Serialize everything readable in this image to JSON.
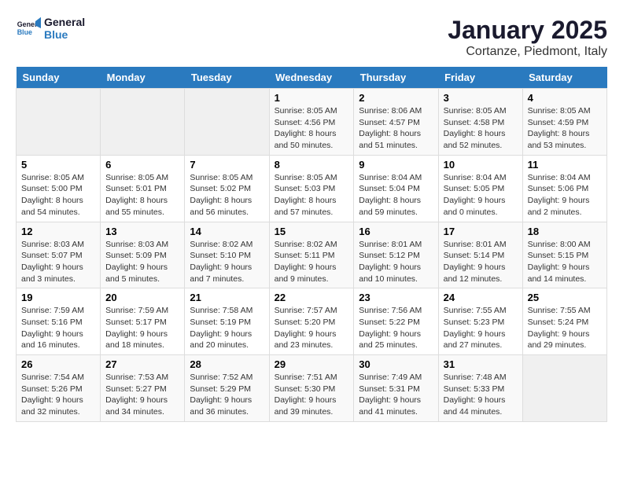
{
  "logo": {
    "line1": "General",
    "line2": "Blue"
  },
  "title": "January 2025",
  "subtitle": "Cortanze, Piedmont, Italy",
  "weekdays": [
    "Sunday",
    "Monday",
    "Tuesday",
    "Wednesday",
    "Thursday",
    "Friday",
    "Saturday"
  ],
  "weeks": [
    [
      {
        "day": "",
        "info": ""
      },
      {
        "day": "",
        "info": ""
      },
      {
        "day": "",
        "info": ""
      },
      {
        "day": "1",
        "info": "Sunrise: 8:05 AM\nSunset: 4:56 PM\nDaylight: 8 hours\nand 50 minutes."
      },
      {
        "day": "2",
        "info": "Sunrise: 8:06 AM\nSunset: 4:57 PM\nDaylight: 8 hours\nand 51 minutes."
      },
      {
        "day": "3",
        "info": "Sunrise: 8:05 AM\nSunset: 4:58 PM\nDaylight: 8 hours\nand 52 minutes."
      },
      {
        "day": "4",
        "info": "Sunrise: 8:05 AM\nSunset: 4:59 PM\nDaylight: 8 hours\nand 53 minutes."
      }
    ],
    [
      {
        "day": "5",
        "info": "Sunrise: 8:05 AM\nSunset: 5:00 PM\nDaylight: 8 hours\nand 54 minutes."
      },
      {
        "day": "6",
        "info": "Sunrise: 8:05 AM\nSunset: 5:01 PM\nDaylight: 8 hours\nand 55 minutes."
      },
      {
        "day": "7",
        "info": "Sunrise: 8:05 AM\nSunset: 5:02 PM\nDaylight: 8 hours\nand 56 minutes."
      },
      {
        "day": "8",
        "info": "Sunrise: 8:05 AM\nSunset: 5:03 PM\nDaylight: 8 hours\nand 57 minutes."
      },
      {
        "day": "9",
        "info": "Sunrise: 8:04 AM\nSunset: 5:04 PM\nDaylight: 8 hours\nand 59 minutes."
      },
      {
        "day": "10",
        "info": "Sunrise: 8:04 AM\nSunset: 5:05 PM\nDaylight: 9 hours\nand 0 minutes."
      },
      {
        "day": "11",
        "info": "Sunrise: 8:04 AM\nSunset: 5:06 PM\nDaylight: 9 hours\nand 2 minutes."
      }
    ],
    [
      {
        "day": "12",
        "info": "Sunrise: 8:03 AM\nSunset: 5:07 PM\nDaylight: 9 hours\nand 3 minutes."
      },
      {
        "day": "13",
        "info": "Sunrise: 8:03 AM\nSunset: 5:09 PM\nDaylight: 9 hours\nand 5 minutes."
      },
      {
        "day": "14",
        "info": "Sunrise: 8:02 AM\nSunset: 5:10 PM\nDaylight: 9 hours\nand 7 minutes."
      },
      {
        "day": "15",
        "info": "Sunrise: 8:02 AM\nSunset: 5:11 PM\nDaylight: 9 hours\nand 9 minutes."
      },
      {
        "day": "16",
        "info": "Sunrise: 8:01 AM\nSunset: 5:12 PM\nDaylight: 9 hours\nand 10 minutes."
      },
      {
        "day": "17",
        "info": "Sunrise: 8:01 AM\nSunset: 5:14 PM\nDaylight: 9 hours\nand 12 minutes."
      },
      {
        "day": "18",
        "info": "Sunrise: 8:00 AM\nSunset: 5:15 PM\nDaylight: 9 hours\nand 14 minutes."
      }
    ],
    [
      {
        "day": "19",
        "info": "Sunrise: 7:59 AM\nSunset: 5:16 PM\nDaylight: 9 hours\nand 16 minutes."
      },
      {
        "day": "20",
        "info": "Sunrise: 7:59 AM\nSunset: 5:17 PM\nDaylight: 9 hours\nand 18 minutes."
      },
      {
        "day": "21",
        "info": "Sunrise: 7:58 AM\nSunset: 5:19 PM\nDaylight: 9 hours\nand 20 minutes."
      },
      {
        "day": "22",
        "info": "Sunrise: 7:57 AM\nSunset: 5:20 PM\nDaylight: 9 hours\nand 23 minutes."
      },
      {
        "day": "23",
        "info": "Sunrise: 7:56 AM\nSunset: 5:22 PM\nDaylight: 9 hours\nand 25 minutes."
      },
      {
        "day": "24",
        "info": "Sunrise: 7:55 AM\nSunset: 5:23 PM\nDaylight: 9 hours\nand 27 minutes."
      },
      {
        "day": "25",
        "info": "Sunrise: 7:55 AM\nSunset: 5:24 PM\nDaylight: 9 hours\nand 29 minutes."
      }
    ],
    [
      {
        "day": "26",
        "info": "Sunrise: 7:54 AM\nSunset: 5:26 PM\nDaylight: 9 hours\nand 32 minutes."
      },
      {
        "day": "27",
        "info": "Sunrise: 7:53 AM\nSunset: 5:27 PM\nDaylight: 9 hours\nand 34 minutes."
      },
      {
        "day": "28",
        "info": "Sunrise: 7:52 AM\nSunset: 5:29 PM\nDaylight: 9 hours\nand 36 minutes."
      },
      {
        "day": "29",
        "info": "Sunrise: 7:51 AM\nSunset: 5:30 PM\nDaylight: 9 hours\nand 39 minutes."
      },
      {
        "day": "30",
        "info": "Sunrise: 7:49 AM\nSunset: 5:31 PM\nDaylight: 9 hours\nand 41 minutes."
      },
      {
        "day": "31",
        "info": "Sunrise: 7:48 AM\nSunset: 5:33 PM\nDaylight: 9 hours\nand 44 minutes."
      },
      {
        "day": "",
        "info": ""
      }
    ]
  ]
}
